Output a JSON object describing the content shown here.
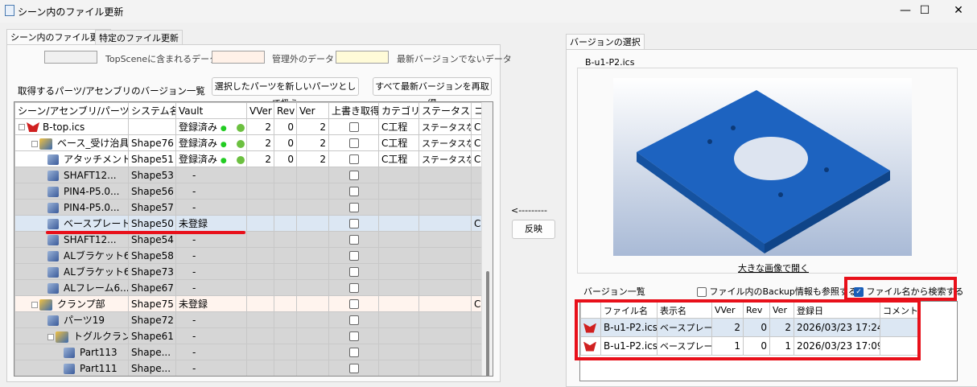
{
  "window": {
    "title": "シーン内のファイル更新",
    "minimize": "—",
    "maximize": "☐",
    "close": "✕"
  },
  "left": {
    "tabs": [
      {
        "label": "シーン内のファイル更新",
        "active": true
      },
      {
        "label": "特定のファイル更新",
        "active": false
      }
    ],
    "legend": [
      {
        "label": "TopSceneに含まれるデータ",
        "color": "#f0f0f0"
      },
      {
        "label": "管理外のデータ",
        "color": "#fff1e8"
      },
      {
        "label": "最新バージョンでないデータ",
        "color": "#fffbd8"
      }
    ],
    "list_label": "取得するパーツ/アセンブリのバージョン一覧",
    "btn_new_parts": "選択したパーツを新しいパーツとして扱う",
    "btn_refetch": "すべて最新バージョンを再取得",
    "columns": [
      "シーン/アセンブリ/パーツ名",
      "システム名",
      "Vault",
      "VVer",
      "Rev",
      "Ver",
      "上書き取得",
      "カテゴリ",
      "ステータス",
      "コ"
    ],
    "rows": [
      {
        "name": "B-top.ics",
        "sys": "",
        "vault": "登録済み",
        "vver": "2",
        "rev": "0",
        "ver": "2",
        "cat": "C工程",
        "status": "ステータスなし",
        "extra": "C",
        "level": 0,
        "icon": "scene",
        "style": "white"
      },
      {
        "name": "ベース_受け治具",
        "sys": "Shape76",
        "vault": "登録済み",
        "vver": "2",
        "rev": "0",
        "ver": "2",
        "cat": "C工程",
        "status": "ステータスなし",
        "extra": "C",
        "level": 1,
        "icon": "assembly",
        "style": "white"
      },
      {
        "name": "アタッチメント",
        "sys": "Shape51",
        "vault": "登録済み",
        "vver": "2",
        "rev": "0",
        "ver": "2",
        "cat": "C工程",
        "status": "ステータスなし",
        "extra": "C",
        "level": 2,
        "icon": "part",
        "style": "white"
      },
      {
        "name": "SHAFT12...",
        "sys": "Shape53",
        "vault": "-",
        "level": 2,
        "icon": "part",
        "style": "gray"
      },
      {
        "name": "PIN4-P5.0...",
        "sys": "Shape56",
        "vault": "-",
        "level": 2,
        "icon": "part",
        "style": "gray"
      },
      {
        "name": "PIN4-P5.0...",
        "sys": "Shape57",
        "vault": "-",
        "level": 2,
        "icon": "part",
        "style": "gray"
      },
      {
        "name": "ベースプレート",
        "sys": "Shape50",
        "vault": "未登録",
        "extra": "C",
        "level": 2,
        "icon": "part",
        "style": "sel"
      },
      {
        "name": "SHAFT12...",
        "sys": "Shape54",
        "vault": "-",
        "level": 2,
        "icon": "part",
        "style": "gray"
      },
      {
        "name": "ALブラケット6",
        "sys": "Shape58",
        "vault": "-",
        "level": 2,
        "icon": "part",
        "style": "gray"
      },
      {
        "name": "ALブラケット6",
        "sys": "Shape73",
        "vault": "-",
        "level": 2,
        "icon": "part",
        "style": "gray"
      },
      {
        "name": "ALフレーム6...",
        "sys": "Shape67",
        "vault": "-",
        "level": 2,
        "icon": "part",
        "style": "gray"
      },
      {
        "name": "クランプ部",
        "sys": "Shape75",
        "vault": "未登録",
        "extra": "C",
        "level": 1,
        "icon": "assembly",
        "style": "peach"
      },
      {
        "name": "パーツ19",
        "sys": "Shape72",
        "vault": "-",
        "level": 2,
        "icon": "part",
        "style": "gray"
      },
      {
        "name": "トグルクラン...",
        "sys": "Shape61",
        "vault": "-",
        "level": 2,
        "icon": "assembly",
        "style": "gray"
      },
      {
        "name": "Part113",
        "sys": "Shape...",
        "vault": "-",
        "level": 3,
        "icon": "part",
        "style": "gray"
      },
      {
        "name": "Part111",
        "sys": "Shape...",
        "vault": "-",
        "level": 3,
        "icon": "part",
        "style": "gray"
      }
    ]
  },
  "middle": {
    "arrow": "<---------",
    "apply": "反映"
  },
  "right": {
    "tab": "バージョンの選択",
    "preview_title": "B-u1-P2.ics",
    "open_large": "大きな画像で開く",
    "version_list_label": "バージョン一覧",
    "backup_checkbox": {
      "label": "ファイル内のBackup情報も参照する",
      "checked": false
    },
    "filename_checkbox": {
      "label": "ファイル名から検索する",
      "checked": true
    },
    "columns": [
      "",
      "ファイル名",
      "表示名",
      "VVer",
      "Rev",
      "Ver",
      "登録日",
      "コメント"
    ],
    "rows": [
      {
        "file": "B-u1-P2.ics",
        "display": "ベースプレート",
        "vver": "2",
        "rev": "0",
        "ver": "2",
        "date": "2026/03/23 17:24",
        "comment": ""
      },
      {
        "file": "B-u1-P2.ics",
        "display": "ベースプレート",
        "vver": "1",
        "rev": "0",
        "ver": "1",
        "date": "2026/03/23 17:09",
        "comment": ""
      }
    ]
  },
  "colors": {
    "highlight": "#e8101a",
    "selected": "#dce7f3",
    "plate": "#1a5fb8"
  }
}
